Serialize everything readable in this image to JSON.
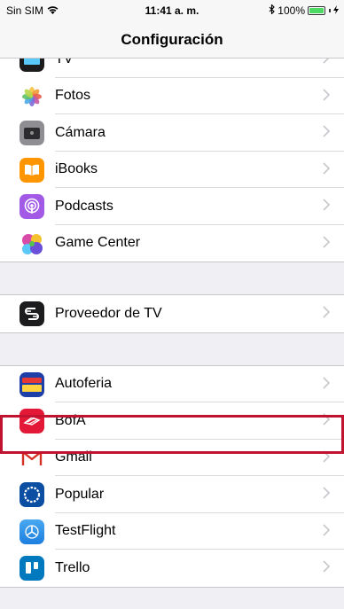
{
  "status": {
    "carrier": "Sin SIM",
    "time": "11:41 a. m.",
    "battery": "100%"
  },
  "nav": {
    "title": "Configuración"
  },
  "group1": [
    {
      "label": "TV",
      "icon": "tv-icon"
    },
    {
      "label": "Fotos",
      "icon": "photos-icon"
    },
    {
      "label": "Cámara",
      "icon": "camera-icon"
    },
    {
      "label": "iBooks",
      "icon": "ibooks-icon"
    },
    {
      "label": "Podcasts",
      "icon": "podcasts-icon"
    },
    {
      "label": "Game Center",
      "icon": "game-center-icon"
    }
  ],
  "group2": [
    {
      "label": "Proveedor de TV",
      "icon": "tv-provider-icon"
    }
  ],
  "group3": [
    {
      "label": "Autoferia",
      "icon": "autoferia-icon"
    },
    {
      "label": "BofA",
      "icon": "bofa-icon"
    },
    {
      "label": "Gmail",
      "icon": "gmail-icon"
    },
    {
      "label": "Popular",
      "icon": "popular-icon"
    },
    {
      "label": "TestFlight",
      "icon": "testflight-icon"
    },
    {
      "label": "Trello",
      "icon": "trello-icon"
    }
  ],
  "colors": {
    "highlight": "#c1122f",
    "battery": "#4cd964"
  }
}
